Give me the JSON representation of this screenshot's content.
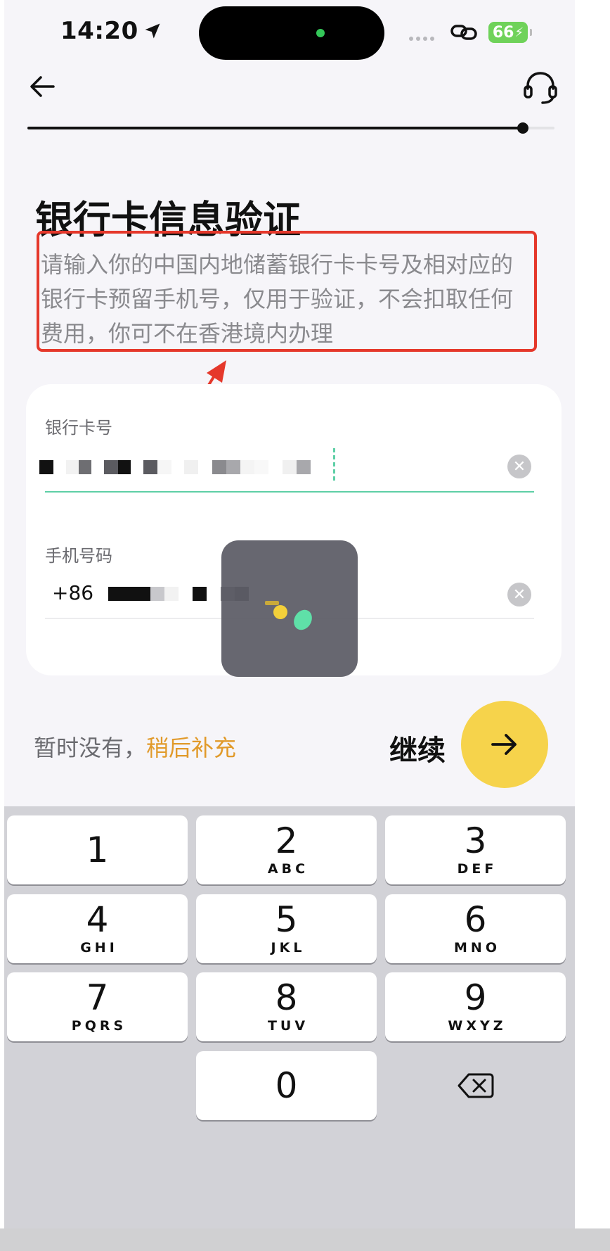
{
  "status_bar": {
    "time": "14:20",
    "battery": "66"
  },
  "header": {
    "back_icon": "arrow-left-icon",
    "support_icon": "headset-icon",
    "progress": 0.94
  },
  "title": "银行卡信息验证",
  "description": "请输入你的中国内地储蓄银行卡卡号及相对应的银行卡预留手机号，仅用于验证，不会扣取任何费用，你可不在香港境内办理",
  "form": {
    "card_label": "银行卡号",
    "phone_label": "手机号码",
    "phone_prefix": "+86"
  },
  "actions": {
    "skip_prefix": "暂时没有，",
    "skip_link": "稍后补充",
    "continue_label": "继续"
  },
  "keypad": {
    "keys": [
      {
        "num": "1",
        "letters": ""
      },
      {
        "num": "2",
        "letters": "ABC"
      },
      {
        "num": "3",
        "letters": "DEF"
      },
      {
        "num": "4",
        "letters": "GHI"
      },
      {
        "num": "5",
        "letters": "JKL"
      },
      {
        "num": "6",
        "letters": "MNO"
      },
      {
        "num": "7",
        "letters": "PQRS"
      },
      {
        "num": "8",
        "letters": "TUV"
      },
      {
        "num": "9",
        "letters": "WXYZ"
      }
    ],
    "zero": "0"
  },
  "colors": {
    "accent_yellow": "#f6d34b",
    "link_orange": "#e19a2a",
    "annotation_red": "#e5382b",
    "focus_green": "#5ecfa6"
  }
}
